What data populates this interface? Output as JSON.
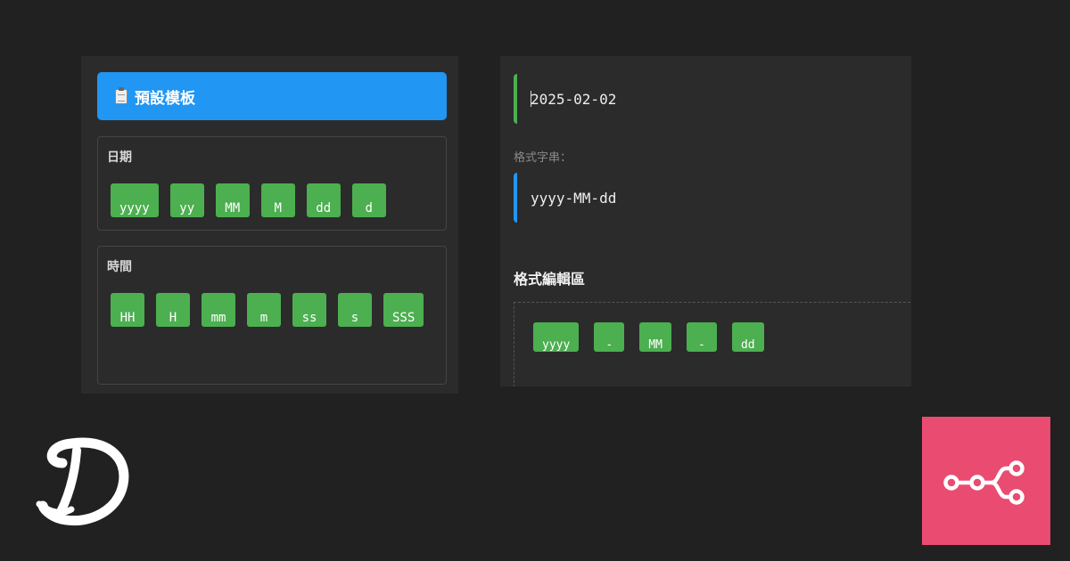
{
  "presets": {
    "title": "預設模板",
    "icon": "clipboard-icon",
    "date_group": {
      "label": "日期",
      "tokens": [
        "yyyy",
        "yy",
        "MM",
        "M",
        "dd",
        "d"
      ]
    },
    "time_group": {
      "label": "時間",
      "tokens": [
        "HH",
        "H",
        "mm",
        "m",
        "ss",
        "s",
        "SSS"
      ]
    }
  },
  "result": {
    "value": "2025-02-02"
  },
  "format": {
    "label": "格式字串：",
    "value": "yyyy-MM-dd"
  },
  "editor": {
    "title": "格式編輯區",
    "tokens": [
      "yyyy",
      "-",
      "MM",
      "-",
      "dd"
    ]
  },
  "brand": {
    "left_logo": "dev-d-logo",
    "right_logo": "n8n-logo-icon",
    "right_logo_color": "#ea4b71"
  },
  "colors": {
    "background": "#212121",
    "panel": "#2b2b2b",
    "accent_blue": "#2196f3",
    "chip_green": "#4caf50"
  }
}
